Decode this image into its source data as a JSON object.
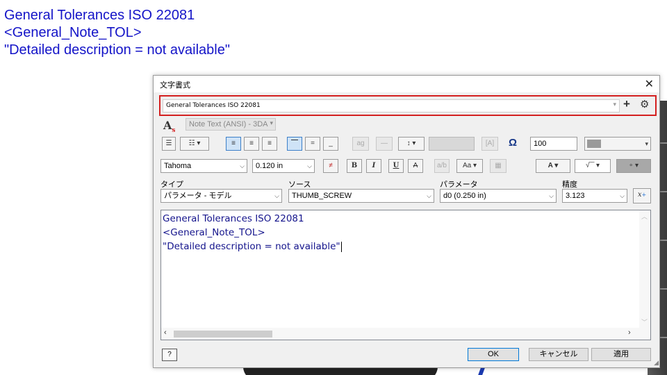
{
  "background": {
    "note_lines": [
      "General Tolerances ISO 22081",
      "<General_Note_TOL>",
      "\"Detailed description = not available\""
    ]
  },
  "dialog": {
    "title": "文字書式",
    "style_name": "General Tolerances ISO 22081",
    "text_style": "Note Text (ANSI) - 3DA",
    "width_factor": "100",
    "font": "Tahoma",
    "font_size": "0.120 in",
    "labels": {
      "type": "タイプ",
      "source": "ソース",
      "parameter": "パラメータ",
      "precision": "精度"
    },
    "type_value": "パラメータ - モデル",
    "source_value": "THUMB_SCREW",
    "parameter_value": "d0 (0.250 in)",
    "precision_value": "3.123",
    "editor_lines": [
      "General Tolerances ISO 22081",
      "<General_Note_TOL>",
      "\"Detailed description = not available\""
    ],
    "help_label": "?",
    "ok_label": "OK",
    "cancel_label": "キャンセル",
    "apply_label": "適用",
    "toolbar_glyphs": {
      "bold": "B",
      "italic": "I",
      "underline": "U",
      "strike": "A",
      "color_a": "A",
      "sqrt": "√",
      "degree": "∘",
      "ag": "ag",
      "omega": "Ω",
      "insert_param": "x"
    }
  },
  "colors": {
    "note_blue": "#1414c8",
    "highlight_red": "#d42020",
    "editor_text": "#14148c"
  }
}
